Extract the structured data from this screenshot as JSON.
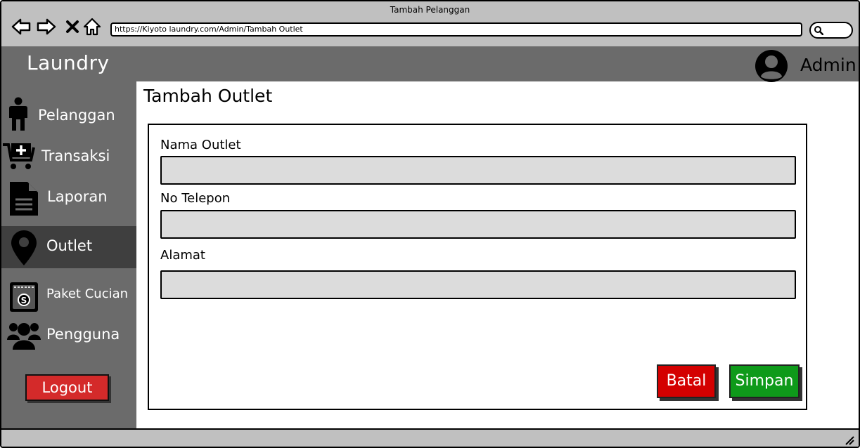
{
  "window": {
    "title": "Tambah Pelanggan"
  },
  "browser": {
    "url": "https://Kiyoto laundry.com/Admin/Tambah Outlet"
  },
  "header": {
    "brand": "Laundry",
    "user": "Admin"
  },
  "sidebar": {
    "items": [
      {
        "label": "Pelanggan",
        "icon": "person-icon",
        "active": false
      },
      {
        "label": "Transaksi",
        "icon": "cart-add-icon",
        "active": false
      },
      {
        "label": "Laporan",
        "icon": "document-icon",
        "active": false
      },
      {
        "label": "Outlet",
        "icon": "map-pin-icon",
        "active": true
      },
      {
        "label": "Paket Cucian",
        "icon": "price-tag-icon",
        "active": false
      },
      {
        "label": "Pengguna",
        "icon": "users-icon",
        "active": false
      }
    ],
    "logout_label": "Logout"
  },
  "main": {
    "title": "Tambah Outlet",
    "form": {
      "fields": [
        {
          "label": "Nama Outlet",
          "value": ""
        },
        {
          "label": "No Telepon",
          "value": ""
        },
        {
          "label": "Alamat",
          "value": ""
        }
      ],
      "cancel_label": "Batal",
      "save_label": "Simpan"
    }
  },
  "colors": {
    "chrome": "#c0c0c0",
    "sidebar": "#6b6b6b",
    "sidebar_active": "#3f3f3f",
    "danger": "#d40000",
    "success": "#0e9a1a"
  }
}
